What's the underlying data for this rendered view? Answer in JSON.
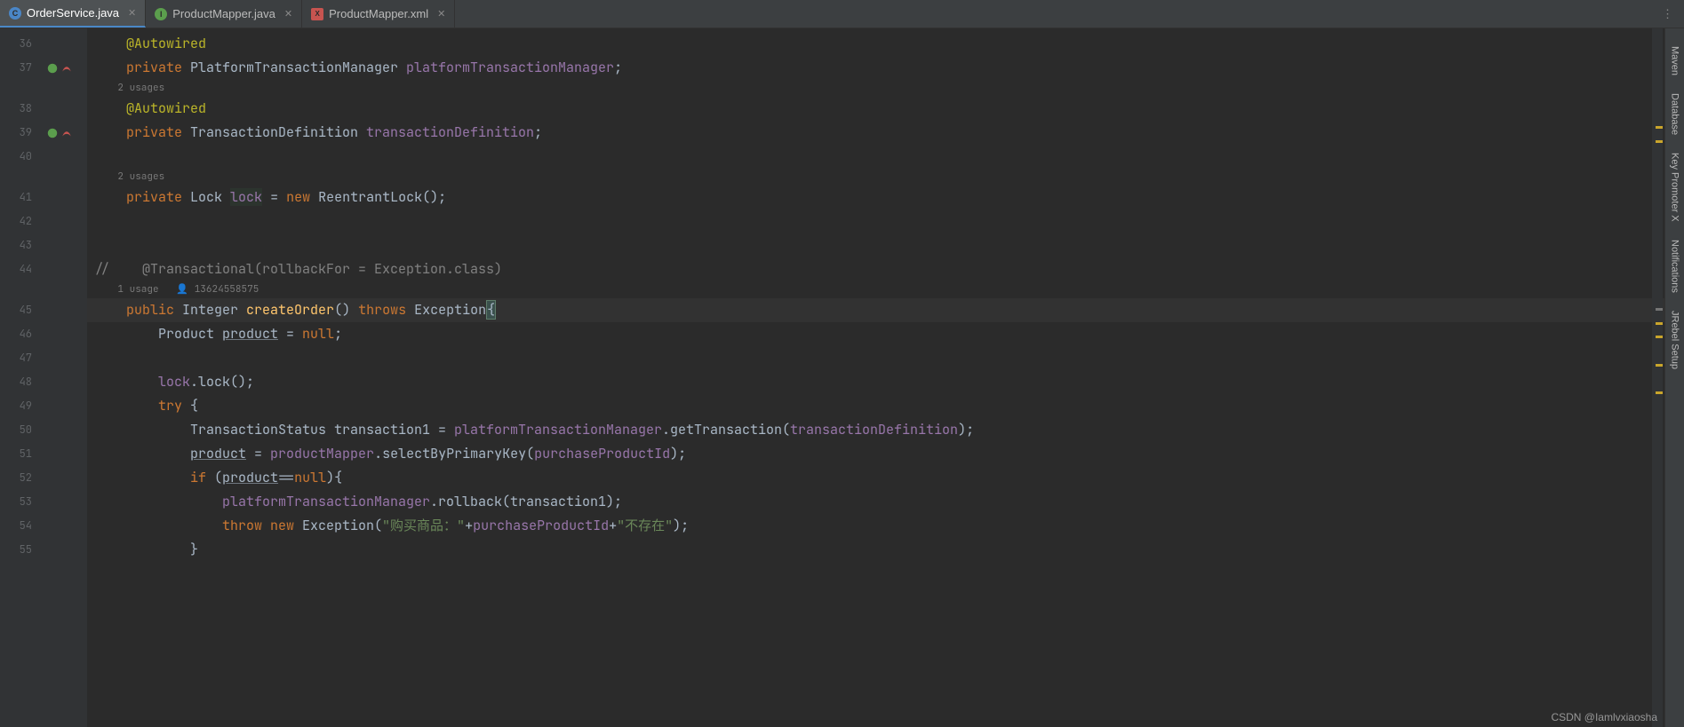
{
  "tabs": [
    {
      "icon": "C",
      "label": "OrderService.java",
      "active": true
    },
    {
      "icon": "I",
      "label": "ProductMapper.java",
      "active": false
    },
    {
      "icon": "X",
      "label": "ProductMapper.xml",
      "active": false
    }
  ],
  "inspections": {
    "warnings": "6",
    "weak_warnings": "2"
  },
  "right_rail": [
    "Maven",
    "Database",
    "Key Promoter X",
    "Notifications",
    "JRebel Setup"
  ],
  "lines": [
    {
      "num": "36",
      "type": "code",
      "tokens": [
        [
          "    ",
          ""
        ],
        [
          "@Autowired",
          "ann"
        ]
      ]
    },
    {
      "num": "37",
      "type": "code",
      "gutter": "bean",
      "tokens": [
        [
          "    ",
          ""
        ],
        [
          "private ",
          "kw"
        ],
        [
          "PlatformTransactionManager ",
          "type"
        ],
        [
          "platformTransactionManager",
          "field"
        ],
        [
          ";",
          ""
        ]
      ]
    },
    {
      "type": "hint",
      "text": "    2 usages"
    },
    {
      "num": "38",
      "type": "code",
      "tokens": [
        [
          "    ",
          ""
        ],
        [
          "@Autowired",
          "ann"
        ]
      ]
    },
    {
      "num": "39",
      "type": "code",
      "gutter": "bean",
      "tokens": [
        [
          "    ",
          ""
        ],
        [
          "private ",
          "kw"
        ],
        [
          "TransactionDefinition ",
          "type"
        ],
        [
          "transactionDefinition",
          "field"
        ],
        [
          ";",
          ""
        ]
      ]
    },
    {
      "num": "40",
      "type": "code",
      "tokens": [
        [
          "",
          ""
        ]
      ]
    },
    {
      "type": "hint",
      "text": "    2 usages"
    },
    {
      "num": "41",
      "type": "code",
      "tokens": [
        [
          "    ",
          ""
        ],
        [
          "private ",
          "kw"
        ],
        [
          "Lock ",
          "type"
        ],
        [
          "lock",
          "field hl"
        ],
        [
          " = ",
          ""
        ],
        [
          "new ",
          "kw"
        ],
        [
          "ReentrantLock();",
          ""
        ]
      ]
    },
    {
      "num": "42",
      "type": "code",
      "tokens": [
        [
          "",
          ""
        ]
      ]
    },
    {
      "num": "43",
      "type": "code",
      "tokens": [
        [
          "",
          ""
        ]
      ]
    },
    {
      "num": "44",
      "type": "code",
      "tokens": [
        [
          "//    @Transactional(rollbackFor = Exception.class)",
          "comment"
        ]
      ]
    },
    {
      "type": "hint",
      "text": "    1 usage   👤 13624558575"
    },
    {
      "num": "45",
      "type": "code",
      "current": true,
      "tokens": [
        [
          "    ",
          ""
        ],
        [
          "public ",
          "kw"
        ],
        [
          "Integer ",
          "type"
        ],
        [
          "createOrder",
          "method"
        ],
        [
          "() ",
          ""
        ],
        [
          "throws ",
          "kw"
        ],
        [
          "Exception",
          ""
        ],
        [
          "{",
          "match-brace"
        ]
      ]
    },
    {
      "num": "46",
      "type": "code",
      "tokens": [
        [
          "        Product ",
          ""
        ],
        [
          "product",
          "underline"
        ],
        [
          " = ",
          ""
        ],
        [
          "null",
          "kw"
        ],
        [
          ";",
          ""
        ]
      ]
    },
    {
      "num": "47",
      "type": "code",
      "tokens": [
        [
          "",
          ""
        ]
      ]
    },
    {
      "num": "48",
      "type": "code",
      "tokens": [
        [
          "        ",
          ""
        ],
        [
          "lock",
          "field"
        ],
        [
          ".lock();",
          ""
        ]
      ]
    },
    {
      "num": "49",
      "type": "code",
      "tokens": [
        [
          "        ",
          ""
        ],
        [
          "try ",
          "kw"
        ],
        [
          "{",
          ""
        ]
      ]
    },
    {
      "num": "50",
      "type": "code",
      "tokens": [
        [
          "            TransactionStatus transaction1 = ",
          ""
        ],
        [
          "platformTransactionManager",
          "field"
        ],
        [
          ".getTransaction(",
          ""
        ],
        [
          "transactionDefinition",
          "field"
        ],
        [
          ");",
          ""
        ]
      ]
    },
    {
      "num": "51",
      "type": "code",
      "tokens": [
        [
          "            ",
          ""
        ],
        [
          "product",
          "underline"
        ],
        [
          " = ",
          ""
        ],
        [
          "productMapper",
          "field"
        ],
        [
          ".selectByPrimaryKey(",
          ""
        ],
        [
          "purchaseProductId",
          "field"
        ],
        [
          ");",
          ""
        ]
      ]
    },
    {
      "num": "52",
      "type": "code",
      "tokens": [
        [
          "            ",
          ""
        ],
        [
          "if ",
          "kw"
        ],
        [
          "(",
          ""
        ],
        [
          "product",
          "underline"
        ],
        [
          "==",
          ""
        ],
        [
          "null",
          "kw"
        ],
        [
          "){",
          ""
        ]
      ]
    },
    {
      "num": "53",
      "type": "code",
      "tokens": [
        [
          "                ",
          ""
        ],
        [
          "platformTransactionManager",
          "field"
        ],
        [
          ".rollback(transaction1);",
          ""
        ]
      ]
    },
    {
      "num": "54",
      "type": "code",
      "tokens": [
        [
          "                ",
          ""
        ],
        [
          "throw new ",
          "kw"
        ],
        [
          "Exception(",
          ""
        ],
        [
          "\"购买商品：\"",
          "str"
        ],
        [
          "+",
          ""
        ],
        [
          "purchaseProductId",
          "field"
        ],
        [
          "+",
          ""
        ],
        [
          "\"不存在\"",
          "str"
        ],
        [
          ");",
          ""
        ]
      ]
    },
    {
      "num": "55",
      "type": "code",
      "tokens": [
        [
          "            }",
          ""
        ]
      ]
    }
  ],
  "watermark": "CSDN @Iamlvxiaosha"
}
